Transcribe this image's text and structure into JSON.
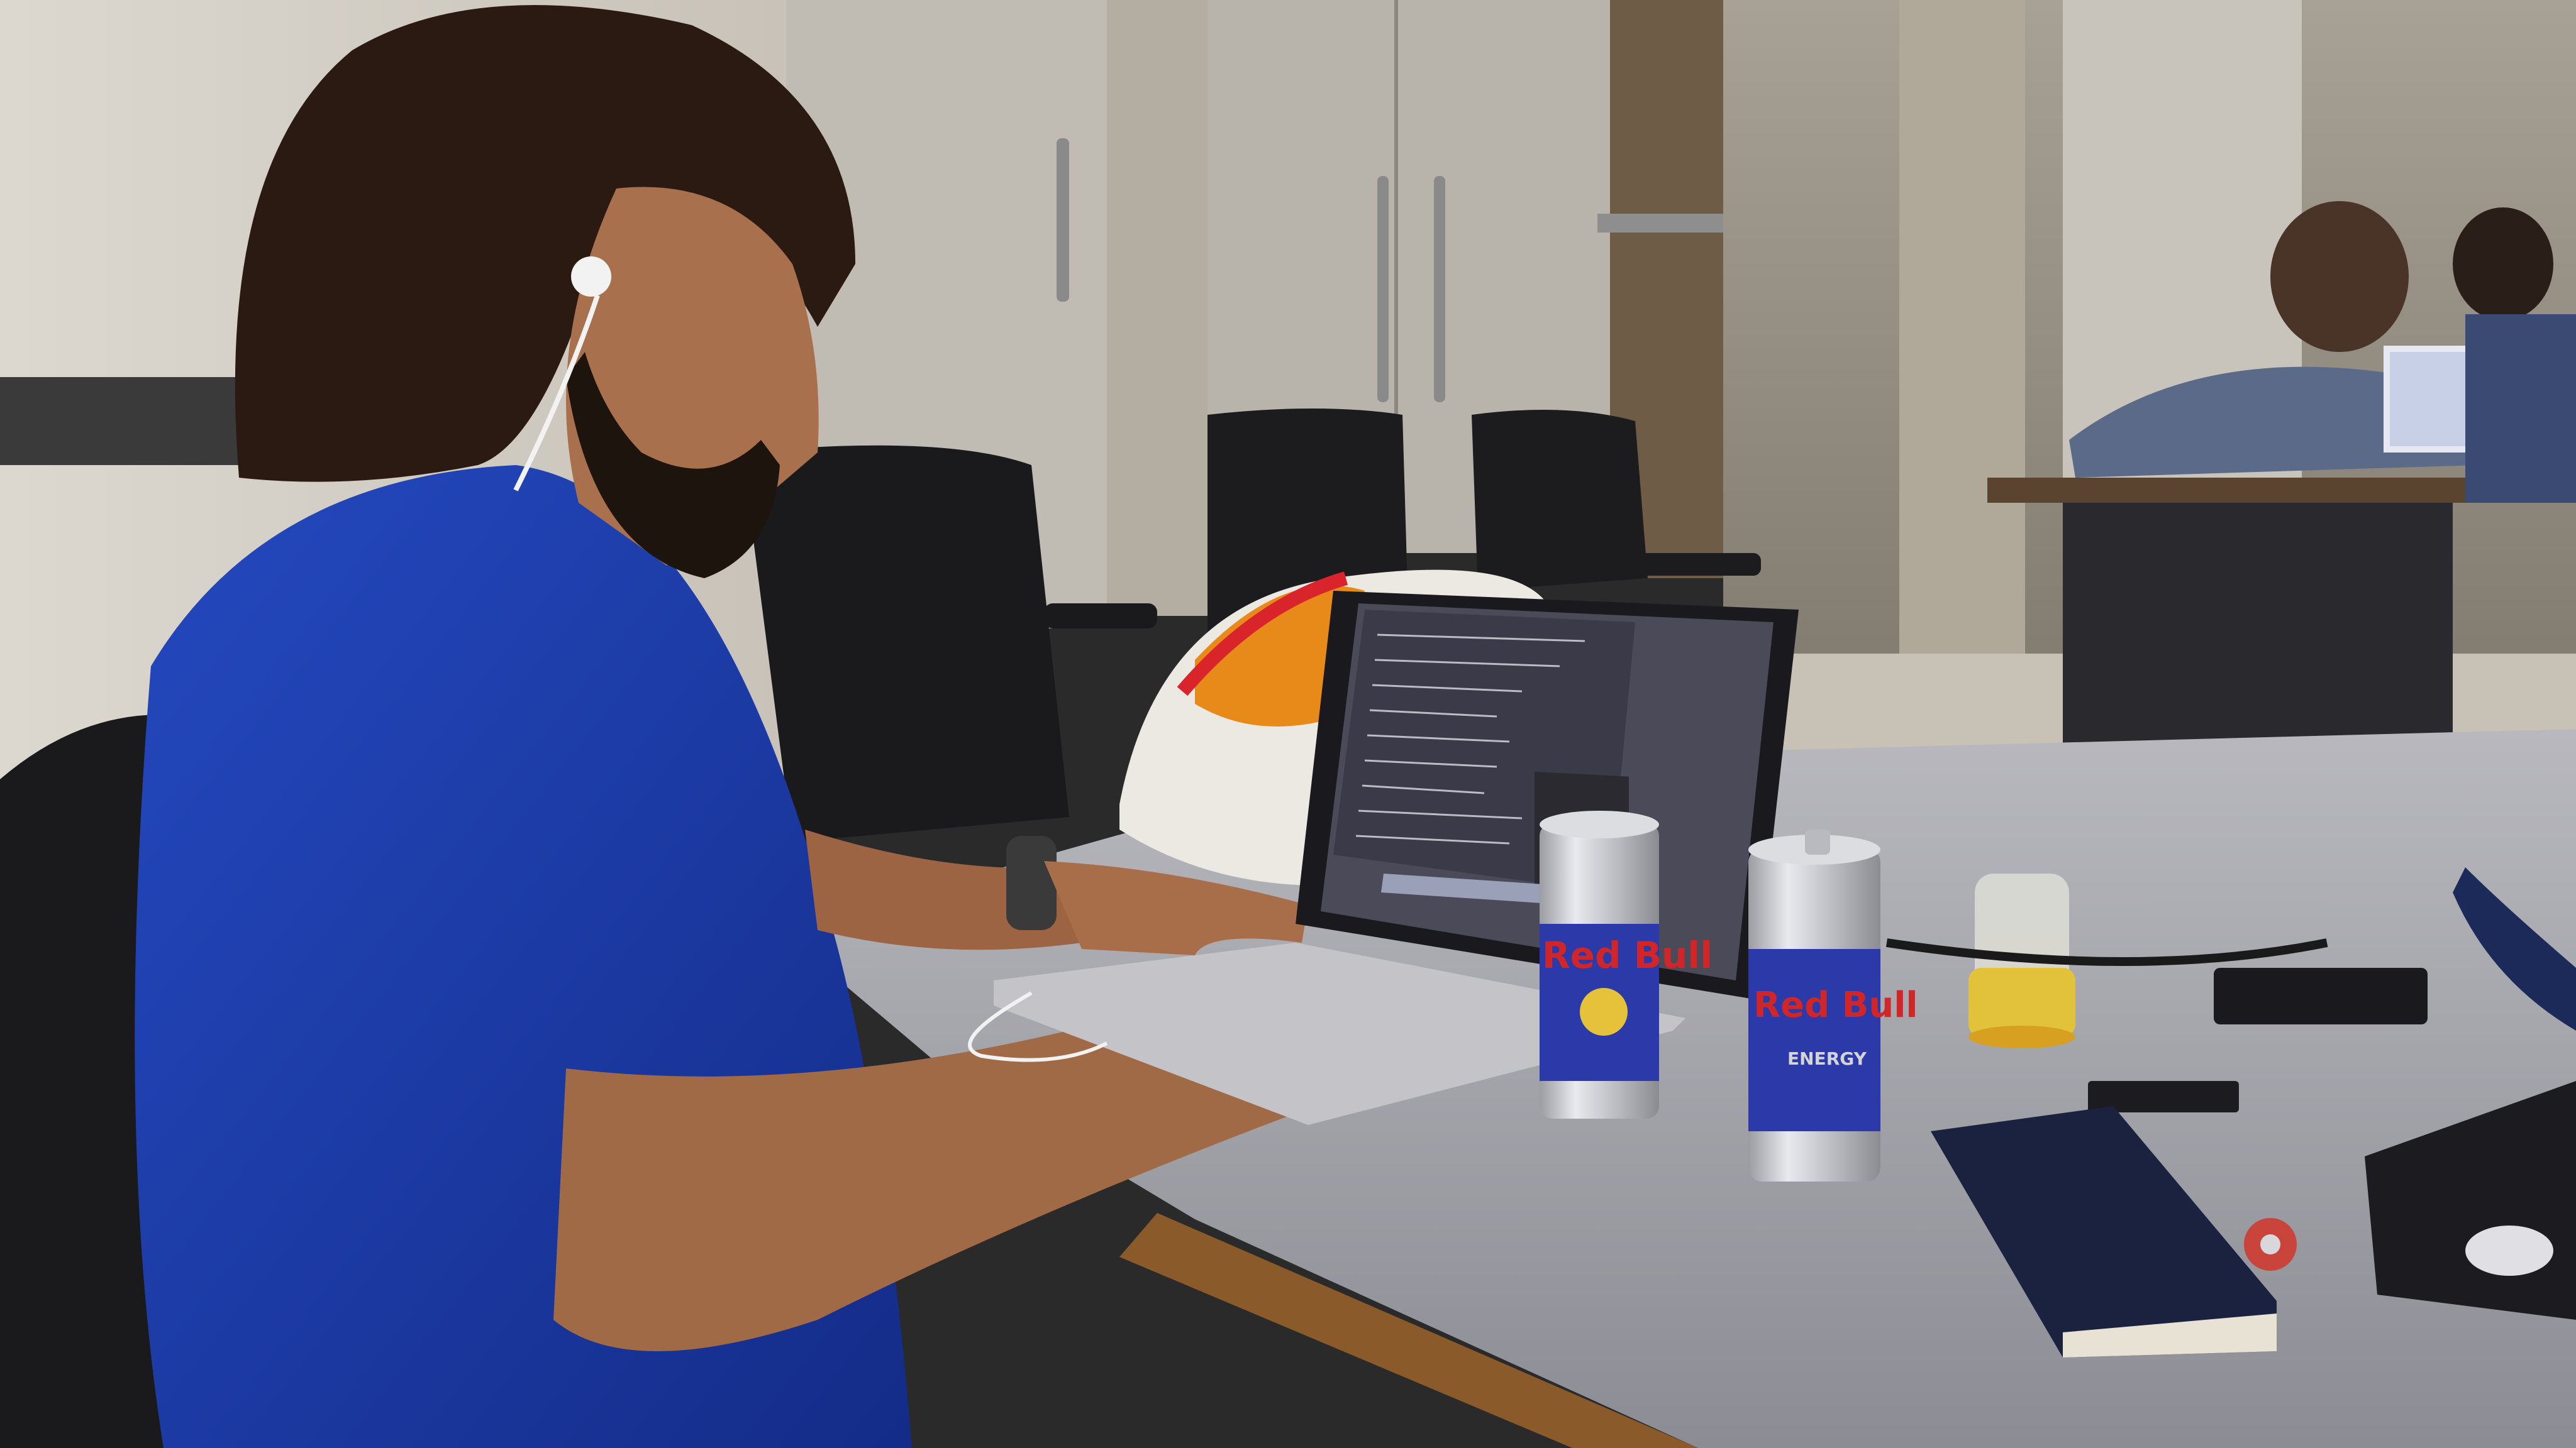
{
  "scene": {
    "description_kind": "photo",
    "palette": {
      "wall": "#d8d4cc",
      "glass_room": "#9a9488",
      "desk": "#9c9ca3",
      "desk_edge": "#8a5a2a",
      "shirt_blue": "#1d3fb0",
      "hair": "#2a1a12",
      "skin": "#b07650",
      "chair": "#1c1c1e",
      "laptop_silver": "#c4c4c8",
      "screen_bg": "#4a4a58",
      "terminal_text": "#e8e8f0",
      "redbull_blue": "#2b3aa8",
      "redbull_red": "#d0262a",
      "redbull_silver": "#d2d4d8",
      "notebook_navy": "#1a2240",
      "toolkit_yellow": "#e2c23a"
    }
  },
  "can_labels": {
    "can_left_brand": "Red Bull",
    "can_right_brand": "Red Bull",
    "can_right_sub": "ENERGY"
  }
}
